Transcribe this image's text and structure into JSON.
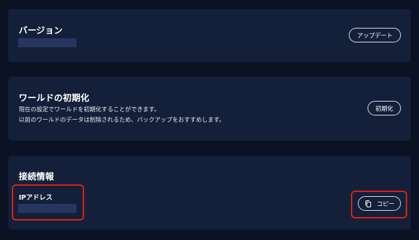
{
  "version": {
    "title": "バージョン",
    "update_label": "アップデート"
  },
  "world_reset": {
    "title": "ワールドの初期化",
    "description_line1": "現在の設定でワールドを初期化することができます。",
    "description_line2": "以前のワールドのデータは削除されるため、バックアップをおすすめします。",
    "reset_label": "初期化"
  },
  "connection": {
    "title": "接続情報",
    "ip_label": "IPアドレス",
    "copy_label": "コピー"
  },
  "colors": {
    "background": "#0a1224",
    "card": "#14203a",
    "redacted": "#283560",
    "highlight": "#e11f12"
  },
  "icons": {
    "copy": "copy-icon"
  }
}
